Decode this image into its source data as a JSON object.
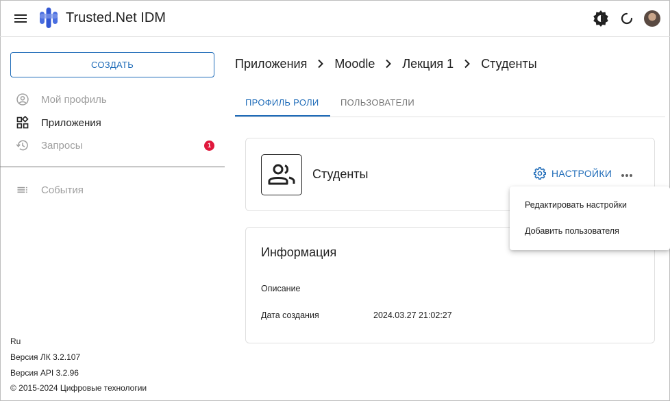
{
  "header": {
    "title": "Trusted.Net IDM",
    "icons": [
      "menu-icon",
      "brightness-icon",
      "refresh-icon",
      "avatar"
    ]
  },
  "sidebar": {
    "create_label": "СОЗДАТЬ",
    "items": [
      {
        "label": "Мой профиль",
        "icon": "account-circle-icon",
        "disabled": true
      },
      {
        "label": "Приложения",
        "icon": "apps-icon",
        "disabled": false
      },
      {
        "label": "Запросы",
        "icon": "history-icon",
        "disabled": true,
        "badge": "1"
      },
      {
        "label": "События",
        "icon": "list-icon",
        "disabled": true
      }
    ],
    "footer": {
      "language": "Ru",
      "lk_version": "Версия ЛК 3.2.107",
      "api_version": "Версия API 3.2.96",
      "copyright": "© 2015-2024 Цифровые технологии"
    }
  },
  "breadcrumb": [
    "Приложения",
    "Moodle",
    "Лекция 1",
    "Студенты"
  ],
  "tabs": [
    {
      "label": "ПРОФИЛЬ РОЛИ",
      "active": true
    },
    {
      "label": "ПОЛЬЗОВАТЕЛИ",
      "active": false
    }
  ],
  "role_card": {
    "name": "Студенты",
    "settings_label": "НАСТРОЙКИ"
  },
  "info_card": {
    "title": "Информация",
    "description_label": "Описание",
    "description_value": "",
    "created_label": "Дата создания",
    "created_value": "2024.03.27 21:02:27"
  },
  "dropdown_menu": {
    "items": [
      "Редактировать настройки",
      "Добавить пользователя"
    ]
  },
  "colors": {
    "accent": "#1e6bb8",
    "badge": "#e0183c",
    "logo": "#4a6ee0"
  }
}
